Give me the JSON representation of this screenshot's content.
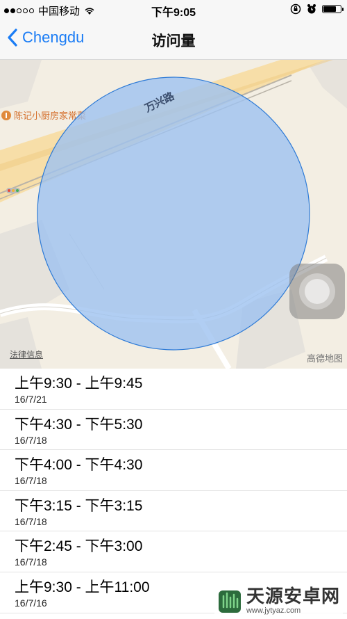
{
  "status_bar": {
    "carrier": "中国移动",
    "time": "下午9:05",
    "signal_dots_filled": 2,
    "signal_dots_total": 5,
    "battery_level": 0.8
  },
  "nav": {
    "back_label": "Chengdu",
    "title": "访问量",
    "accent_color": "#1a7cf5"
  },
  "map": {
    "road_label": "万兴路",
    "poi_label": "陈记小厨房家常菜",
    "legal_link": "法律信息",
    "provider": "高德地图",
    "region_color": "#a9cbf2"
  },
  "visits": [
    {
      "time": "上午9:30 - 上午9:45",
      "date": "16/7/21"
    },
    {
      "time": "下午4:30 - 下午5:30",
      "date": "16/7/18"
    },
    {
      "time": "下午4:00 - 下午4:30",
      "date": "16/7/18"
    },
    {
      "time": "下午3:15 - 下午3:15",
      "date": "16/7/18"
    },
    {
      "time": "下午2:45 - 下午3:00",
      "date": "16/7/18"
    },
    {
      "time": "上午9:30 - 上午11:00",
      "date": "16/7/16"
    }
  ],
  "watermark": {
    "title": "天源安卓网",
    "url": "www.jytyaz.com"
  }
}
